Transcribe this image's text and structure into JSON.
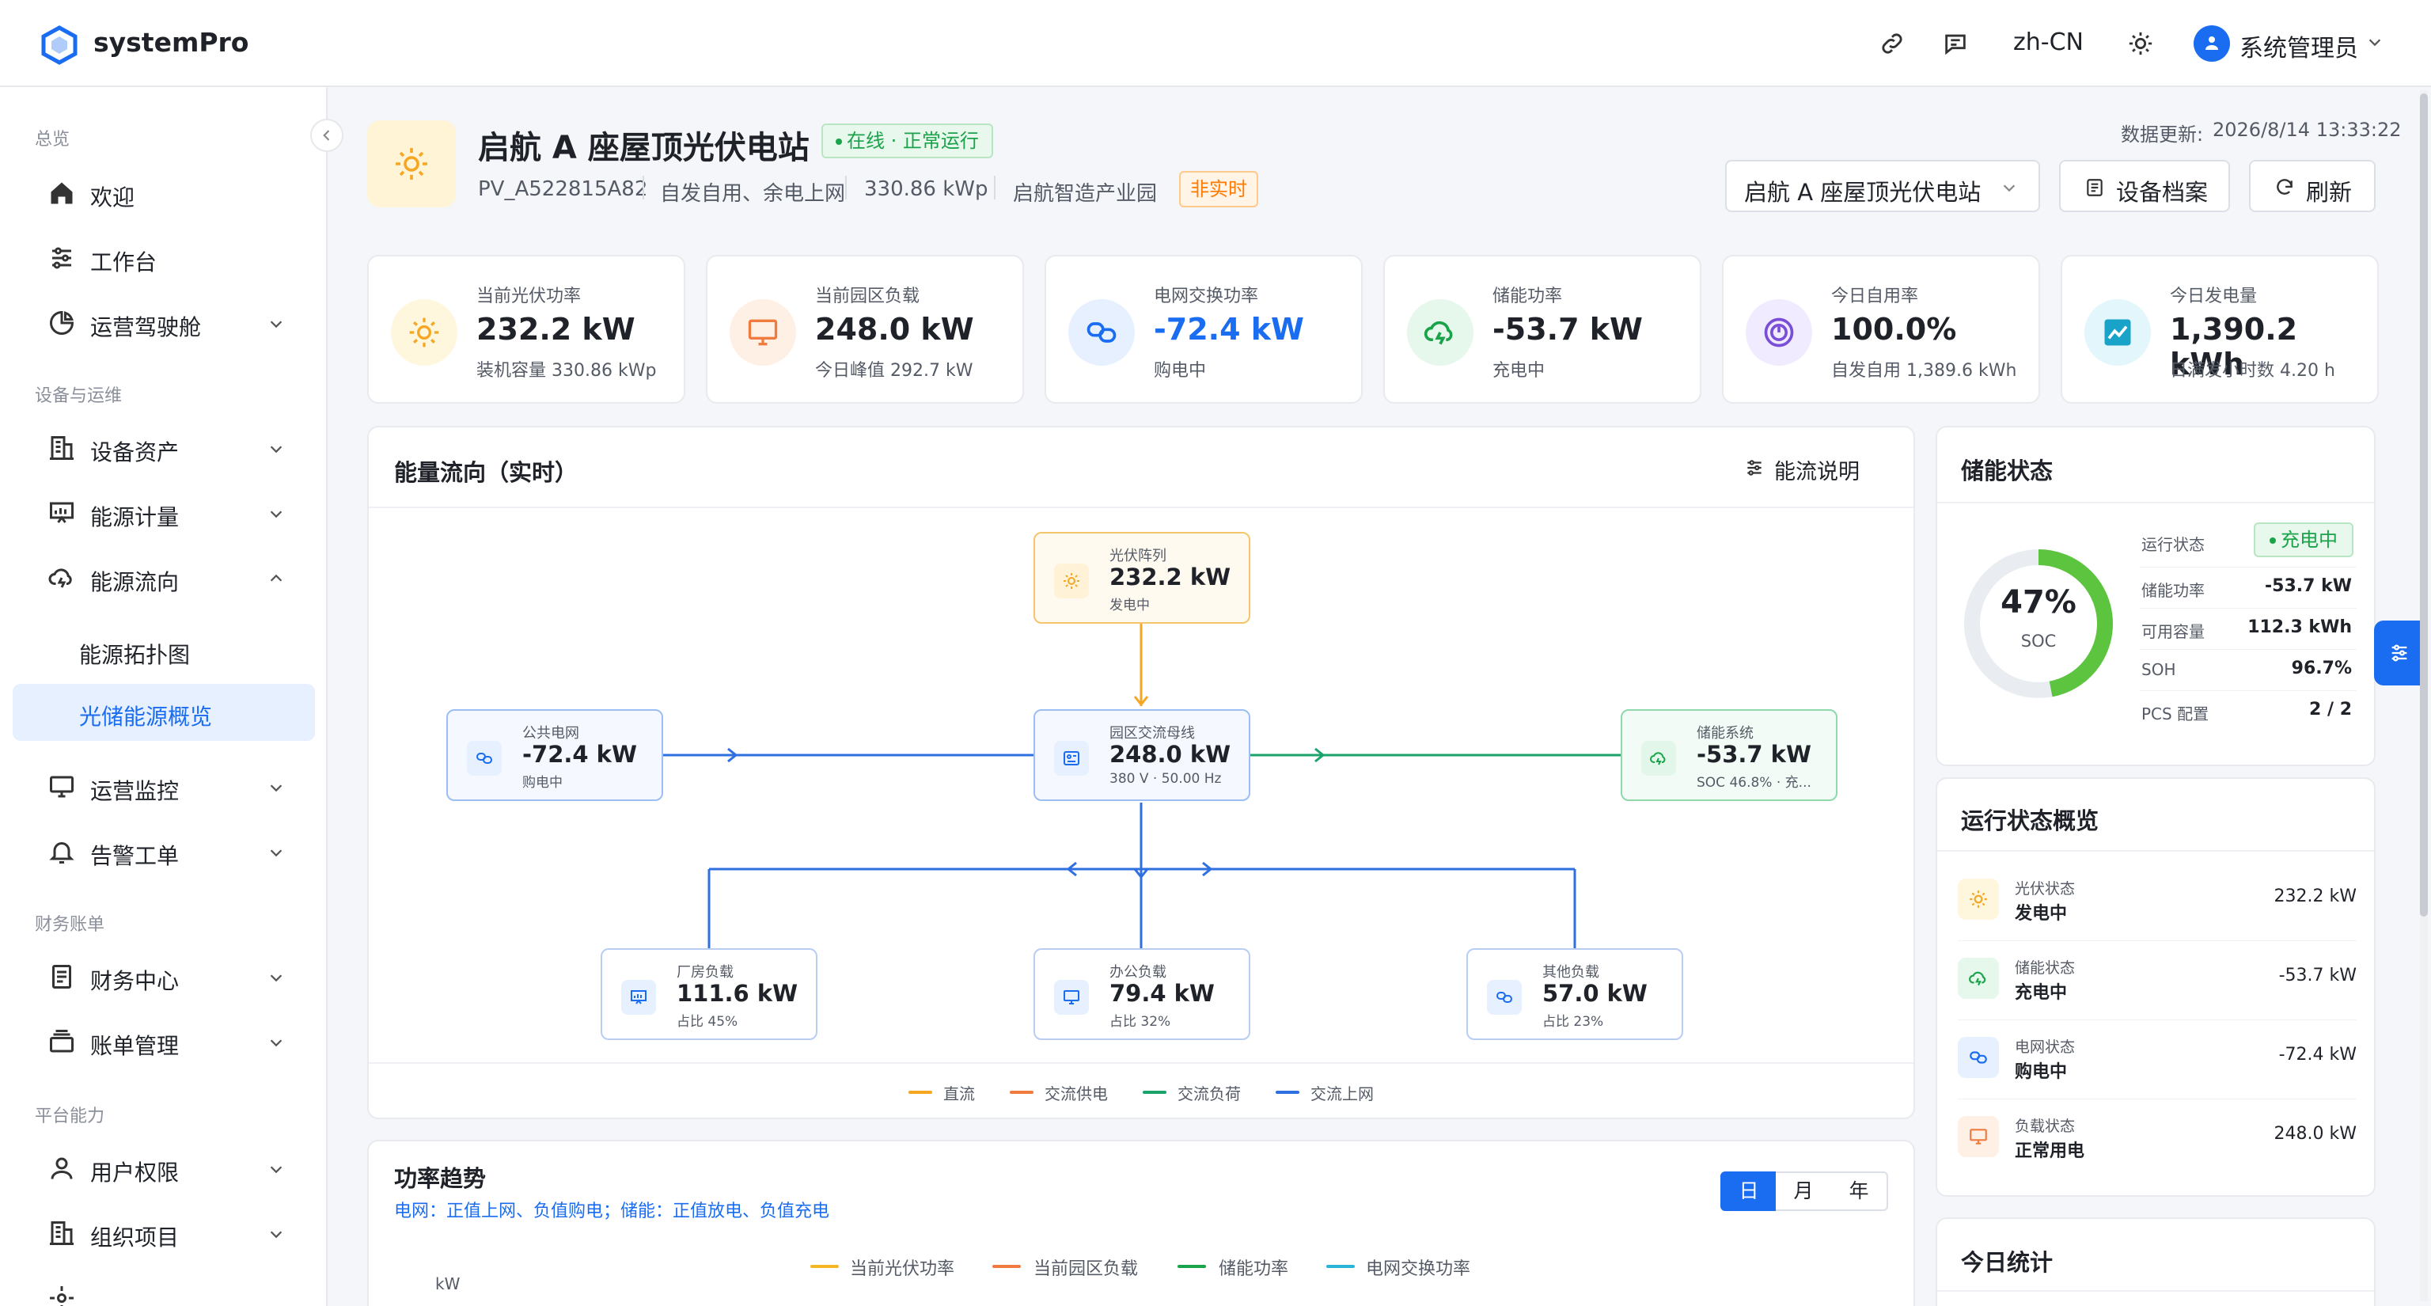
{
  "app": {
    "name": "systemPro"
  },
  "topbar": {
    "lang": "zh-CN",
    "user": "系统管理员"
  },
  "sidebar": {
    "groups": [
      "总览",
      "设备与运维",
      "财务账单",
      "平台能力"
    ],
    "items": {
      "welcome": "欢迎",
      "workbench": "工作台",
      "cockpit": "运营驾驶舱",
      "assets": "设备资产",
      "metering": "能源计量",
      "flow": "能源流向",
      "topology": "能源拓扑图",
      "pv_overview": "光储能源概览",
      "monitor": "运营监控",
      "alarm": "告警工单",
      "finance": "财务中心",
      "billing": "账单管理",
      "users": "用户权限",
      "org": "组织项目"
    }
  },
  "header": {
    "station_name": "启航 A 座屋顶光伏电站",
    "status": "在线 · 正常运行",
    "station_id": "PV_A522815A82",
    "mode": "自发自用、余电上网",
    "capacity": "330.86 kWp",
    "park": "启航智造产业园",
    "realtime_tag": "非实时",
    "update_label": "数据更新:",
    "update_time": "2026/8/14 13:33:22",
    "select_value": "启航 A 座屋顶光伏电站",
    "btn_archive": "设备档案",
    "btn_refresh": "刷新"
  },
  "kpis": [
    {
      "label": "当前光伏功率",
      "value": "232.2 kW",
      "sub": "装机容量 330.86 kWp",
      "color": "#f5a623",
      "bg": "#fff6de",
      "icon": "sun-icon"
    },
    {
      "label": "当前园区负载",
      "value": "248.0 kW",
      "sub": "今日峰值 292.7 kW",
      "color": "#f07b3f",
      "bg": "#fff0e6",
      "icon": "monitor-icon"
    },
    {
      "label": "电网交换功率",
      "value": "-72.4 kW",
      "sub": "购电中",
      "color": "#1a6cf0",
      "bg": "#e7f0ff",
      "icon": "grid-link-icon"
    },
    {
      "label": "储能功率",
      "value": "-53.7 kW",
      "sub": "充电中",
      "color": "#1aa34a",
      "bg": "#e6f7ec",
      "icon": "cloud-bolt-icon"
    },
    {
      "label": "今日自用率",
      "value": "100.0%",
      "sub": "自发自用 1,389.6 kWh",
      "color": "#7a4fd8",
      "bg": "#f1ebff",
      "icon": "gauge-icon"
    },
    {
      "label": "今日发电量",
      "value": "1,390.2 kWh",
      "sub": "日满发小时数 4.20 h",
      "color": "#1aa3c8",
      "bg": "#e3f6fb",
      "icon": "trend-icon"
    }
  ],
  "flow": {
    "title": "能量流向（实时）",
    "explain": "能流说明",
    "nodes": {
      "pv": {
        "label": "光伏阵列",
        "value": "232.2 kW",
        "sub": "发电中"
      },
      "grid": {
        "label": "公共电网",
        "value": "-72.4 kW",
        "sub": "购电中"
      },
      "bus": {
        "label": "园区交流母线",
        "value": "248.0 kW",
        "sub": "380 V · 50.00 Hz"
      },
      "storage": {
        "label": "储能系统",
        "value": "-53.7 kW",
        "sub": "SOC 46.8% · 充..."
      },
      "factory": {
        "label": "厂房负载",
        "value": "111.6 kW",
        "sub": "占比 45%"
      },
      "office": {
        "label": "办公负载",
        "value": "79.4 kW",
        "sub": "占比 32%"
      },
      "other": {
        "label": "其他负载",
        "value": "57.0 kW",
        "sub": "占比 23%"
      }
    },
    "legend": [
      {
        "name": "直流",
        "color": "#f5a623"
      },
      {
        "name": "交流供电",
        "color": "#f07b3f"
      },
      {
        "name": "交流负荷",
        "color": "#1aa36a"
      },
      {
        "name": "交流上网",
        "color": "#2f6fe0"
      }
    ]
  },
  "storage": {
    "title": "储能状态",
    "soc": "47%",
    "soc_label": "SOC",
    "soc_fraction": 0.47,
    "run_state_label": "运行状态",
    "run_state": "充电中",
    "rows": [
      {
        "label": "储能功率",
        "value": "-53.7 kW"
      },
      {
        "label": "可用容量",
        "value": "112.3 kWh"
      },
      {
        "label": "SOH",
        "value": "96.7%"
      },
      {
        "label": "PCS 配置",
        "value": "2 / 2"
      }
    ]
  },
  "run_status": {
    "title": "运行状态概览",
    "rows": [
      {
        "label": "光伏状态",
        "state": "发电中",
        "value": "232.2 kW",
        "color": "#f5a623",
        "bg": "#fff6de"
      },
      {
        "label": "储能状态",
        "state": "充电中",
        "value": "-53.7 kW",
        "color": "#1aa34a",
        "bg": "#e6f7ec"
      },
      {
        "label": "电网状态",
        "state": "购电中",
        "value": "-72.4 kW",
        "color": "#1a6cf0",
        "bg": "#e7f0ff"
      },
      {
        "label": "负载状态",
        "state": "正常用电",
        "value": "248.0 kW",
        "color": "#f07b3f",
        "bg": "#fff0e6"
      }
    ]
  },
  "today": {
    "title": "今日统计"
  },
  "trend": {
    "title": "功率趋势",
    "note": "电网：正值上网、负值购电；储能：正值放电、负值充电",
    "periods": [
      "日",
      "月",
      "年"
    ],
    "active_period": "日",
    "unit": "kW",
    "legend": [
      {
        "name": "当前光伏功率",
        "color": "#f5b623"
      },
      {
        "name": "当前园区负载",
        "color": "#f07b3f"
      },
      {
        "name": "储能功率",
        "color": "#1aa34a"
      },
      {
        "name": "电网交换功率",
        "color": "#29b6d6"
      }
    ]
  }
}
